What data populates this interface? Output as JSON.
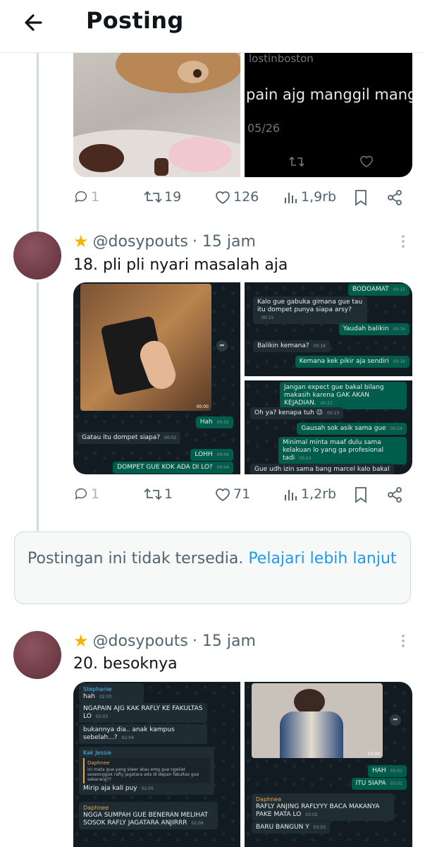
{
  "header": {
    "title": "Posting"
  },
  "post1": {
    "quoted_handle": "lostinboston",
    "quoted_text": "pain ajg manggil mangg",
    "quoted_date": "05/26",
    "stats": {
      "replies": "1",
      "reposts": "19",
      "likes": "126",
      "views": "1,9rb"
    }
  },
  "post2": {
    "handle": "@dosypouts",
    "time": "· 15 jam",
    "text": "18. pli pli nyari masalah aja",
    "chat_left": {
      "time_img": "00:00",
      "m1": "Hah",
      "m1t": "00:02",
      "m2": "Gatau itu dompet siapa?",
      "m2t": "00:02",
      "m3": "LOHH",
      "m3t": "00:04",
      "m4": "DOMPET GUE KOK ADA DI LO?",
      "m4t": "00:04"
    },
    "chat_right_top": {
      "m0": "BODOAMAT",
      "m0t": "00:15",
      "m1": "Kalo gue gabuka gimana gue tau itu dompet punya siapa arsy?",
      "m1t": "00:15",
      "m2": "Yaudah balikin",
      "m2t": "00:16",
      "m3": "Balikin kemana?",
      "m3t": "00:16",
      "m4": "Kemana kek pikir aja sendiri",
      "m4t": "00:16"
    },
    "chat_right_bottom": {
      "m1": "Jangan expect gue bakal bilang makasih karena GAK AKAN KEJADIAN.",
      "m1t": "00:23",
      "m2": "Oh ya? kenapa tuh 😉",
      "m2t": "00:23",
      "m3": "Gausah sok asik sama gue",
      "m3t": "00:24",
      "m4": "Minimal minta maaf dulu sama kelakuan lo yang ga profesional tadi",
      "m4t": "00:24",
      "m5": "Gue udh izin sama bang marcel kalo bakal"
    },
    "stats": {
      "replies": "1",
      "reposts": "1",
      "likes": "71",
      "views": "1,2rb"
    }
  },
  "unavailable": {
    "text": "Postingan ini tidak tersedia.",
    "link": "Pelajari lebih lanjut"
  },
  "post3": {
    "handle": "@dosypouts",
    "time": "· 15 jam",
    "text": "20. besoknya",
    "chat_left": {
      "s1name": "Stephanie",
      "s1": "hah",
      "s1t": "02:03",
      "m1": "NGAPAIN AJG KAK RAFLY KE FAKULTAS LO",
      "m1t": "02:03",
      "m2": "bukannya dia.. anak kampus sebelah...?",
      "m2t": "02:04",
      "q1name": "Kak Jessie",
      "q2name": "Daphnee",
      "q2text": "ini mata gue yang siwer atau emg gue ngeliat seseonggok rafly jagatara ada di depan fakultas gue sekarang??",
      "m3": "Mirip aja kali puy",
      "m3t": "02:05",
      "s2name": "Daphnee",
      "m4": "NGGA SUMPAH GUE BENERAN MELIHAT SOSOK RAFLY JAGATARA ANJIRRR",
      "m4t": "02:06"
    },
    "chat_right": {
      "time_img": "03:00",
      "m1": "HAH",
      "m1t": "03:01",
      "m2": "ITU SIAPA",
      "m2t": "03:01",
      "rname": "Daphnee",
      "m3": "RAFLY ANJING RAFLYYY BACA MAKANYA PAKE MATA LO",
      "m3t": "03:02",
      "m4": "BARU BANGUN Y",
      "m4t": "03:03"
    }
  }
}
